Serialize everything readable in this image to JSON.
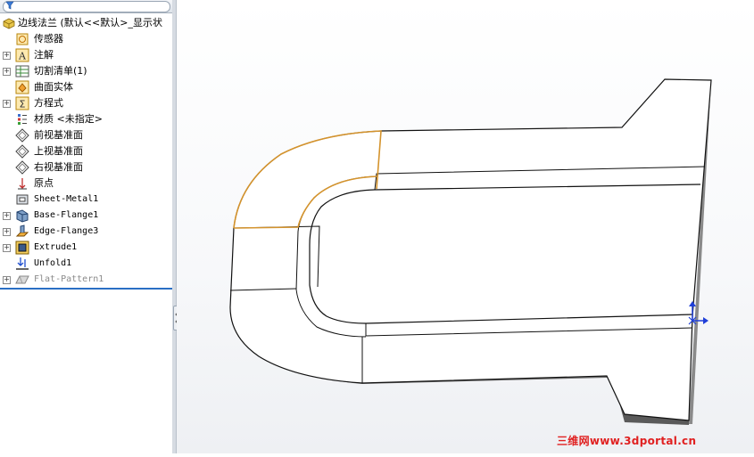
{
  "feature_tree": {
    "root_label": "边线法兰  (默认<<默认>_显示状",
    "items": [
      {
        "label": "传感器",
        "icon": "sensor-icon",
        "expandable": false
      },
      {
        "label": "注解",
        "icon": "annotation-icon",
        "expandable": true
      },
      {
        "label": "切割清单(1)",
        "icon": "cut-list-icon",
        "expandable": true
      },
      {
        "label": "曲面实体",
        "icon": "surface-body-icon",
        "expandable": false
      },
      {
        "label": "方程式",
        "icon": "equation-icon",
        "expandable": true
      },
      {
        "label": "材质 <未指定>",
        "icon": "material-icon",
        "expandable": false
      },
      {
        "label": "前视基准面",
        "icon": "plane-icon",
        "expandable": false
      },
      {
        "label": "上视基准面",
        "icon": "plane-icon",
        "expandable": false
      },
      {
        "label": "右视基准面",
        "icon": "plane-icon",
        "expandable": false
      },
      {
        "label": "原点",
        "icon": "origin-icon",
        "expandable": false
      },
      {
        "label": "Sheet-Metal1",
        "icon": "sheet-metal-icon",
        "expandable": false
      },
      {
        "label": "Base-Flange1",
        "icon": "base-flange-icon",
        "expandable": true
      },
      {
        "label": "Edge-Flange3",
        "icon": "edge-flange-icon",
        "expandable": true
      },
      {
        "label": "Extrude1",
        "icon": "extrude-icon",
        "expandable": true
      },
      {
        "label": "Unfold1",
        "icon": "unfold-icon",
        "expandable": false
      },
      {
        "label": "Flat-Pattern1",
        "icon": "flat-pattern-icon",
        "expandable": true,
        "suppressed": true
      }
    ]
  },
  "watermark": "三维网www.3dportal.cn",
  "colors": {
    "rollback_bar": "#2a6fc4",
    "selected_edge": "#d4932c",
    "triad_blue": "#1f3fd8",
    "watermark": "#e02020"
  }
}
